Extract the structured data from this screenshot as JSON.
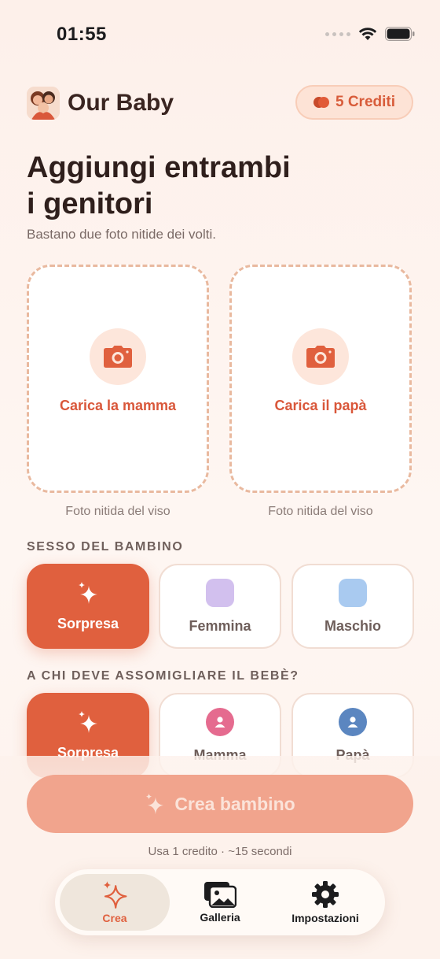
{
  "status_bar": {
    "time": "01:55"
  },
  "header": {
    "app_name": "Our Baby",
    "credits_label": "5 Crediti"
  },
  "main": {
    "title_line1": "Aggiungi entrambi",
    "title_line2": "i genitori",
    "subtitle": "Bastano due foto nitide dei volti.",
    "upload_cards": [
      {
        "label": "Carica la mamma",
        "hint": "Foto nitida del viso"
      },
      {
        "label": "Carica il papà",
        "hint": "Foto nitida del viso"
      }
    ]
  },
  "sex_section": {
    "label": "SESSO DEL BAMBINO",
    "options": [
      {
        "label": "Sorpresa",
        "selected": true,
        "icon": "sparkles-icon"
      },
      {
        "label": "Femmina",
        "selected": false,
        "color": "#d2c0ee"
      },
      {
        "label": "Maschio",
        "selected": false,
        "color": "#a9caf0"
      }
    ]
  },
  "resemble_section": {
    "label": "A CHI DEVE ASSOMIGLIARE IL BEBÈ?",
    "options": [
      {
        "label": "Sorpresa",
        "selected": true,
        "icon": "sparkles-icon"
      },
      {
        "label": "Mamma",
        "selected": false,
        "icon": "person-icon",
        "color": "#e56b8f"
      },
      {
        "label": "Papà",
        "selected": false,
        "icon": "person-icon",
        "color": "#5b86c0"
      }
    ]
  },
  "cta": {
    "label": "Crea bambino",
    "hint": "Usa 1 credito · ~15 secondi"
  },
  "tabbar": {
    "tabs": [
      {
        "label": "Crea",
        "active": true
      },
      {
        "label": "Galleria",
        "active": false
      },
      {
        "label": "Impostazioni",
        "active": false
      }
    ]
  },
  "colors": {
    "accent": "#e0603e",
    "accent_light": "#fde6db",
    "cta_disabled": "#f1a48d"
  }
}
